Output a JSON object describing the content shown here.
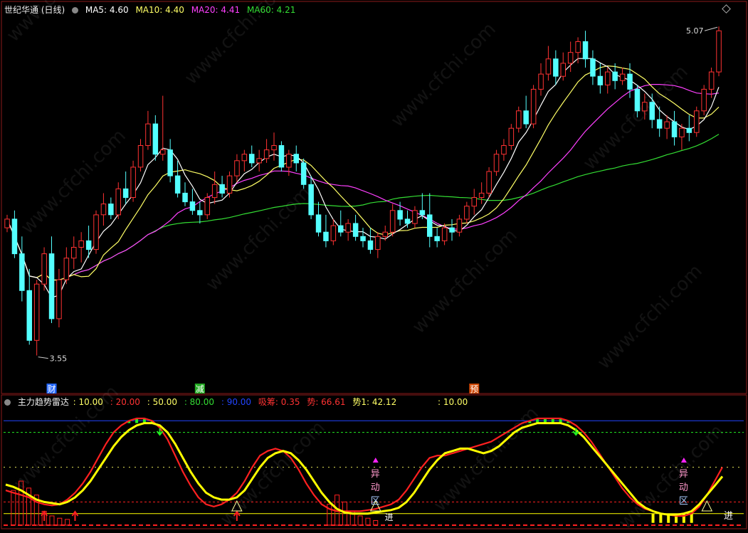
{
  "top_legend": {
    "title": "世纪华通 (日线)",
    "ma5": "MA5: 4.60",
    "ma10": "MA10: 4.40",
    "ma20": "MA20: 4.41",
    "ma60": "MA60: 4.21"
  },
  "bottom_legend": {
    "title": "主力趋势雷达",
    "v1": ": 10.00",
    "v2": ": 20.00",
    "v3": ": 50.00",
    "v4": ": 80.00",
    "v5": ": 90.00",
    "v6": "吸筹: 0.35",
    "v7": "势: 66.61",
    "v8": "势1: 42.12",
    "v9": ": 10.00"
  },
  "colors": {
    "up": "#ff3232",
    "down": "#54ffff",
    "ma5": "#ffffff",
    "ma10": "#ffff66",
    "ma20": "#ff40ff",
    "ma60": "#33dd33",
    "yellow": "#ffff00",
    "red": "#ff2020",
    "green": "#22ee22",
    "blue": "#2244ff"
  },
  "chart_data": [
    {
      "type": "candlestick",
      "title": "世纪华通 (日线)",
      "price_labels": {
        "high": "5.07",
        "low": "3.55"
      },
      "ylim": [
        3.45,
        5.12
      ],
      "event_markers": [
        "财",
        "减",
        "预"
      ],
      "ohlc": [
        [
          4.14,
          4.2,
          4.12,
          4.18
        ],
        [
          4.18,
          4.22,
          4.0,
          4.02
        ],
        [
          4.02,
          4.1,
          3.8,
          3.85
        ],
        [
          3.85,
          3.95,
          3.6,
          3.62
        ],
        [
          3.62,
          3.9,
          3.55,
          3.88
        ],
        [
          3.88,
          4.05,
          3.85,
          4.02
        ],
        [
          4.02,
          4.1,
          3.7,
          3.72
        ],
        [
          3.72,
          3.95,
          3.68,
          3.9
        ],
        [
          3.9,
          4.05,
          3.88,
          4.0
        ],
        [
          4.0,
          4.1,
          3.95,
          4.05
        ],
        [
          4.05,
          4.12,
          3.98,
          4.08
        ],
        [
          4.08,
          4.15,
          4.0,
          4.04
        ],
        [
          4.04,
          4.22,
          4.02,
          4.2
        ],
        [
          4.2,
          4.3,
          4.15,
          4.25
        ],
        [
          4.25,
          4.28,
          4.18,
          4.2
        ],
        [
          4.2,
          4.35,
          4.18,
          4.32
        ],
        [
          4.32,
          4.4,
          4.25,
          4.28
        ],
        [
          4.28,
          4.45,
          4.26,
          4.42
        ],
        [
          4.42,
          4.55,
          4.4,
          4.52
        ],
        [
          4.52,
          4.68,
          4.5,
          4.62
        ],
        [
          4.62,
          4.66,
          4.45,
          4.48
        ],
        [
          4.48,
          4.75,
          4.45,
          4.5
        ],
        [
          4.5,
          4.55,
          4.35,
          4.38
        ],
        [
          4.38,
          4.45,
          4.28,
          4.3
        ],
        [
          4.3,
          4.35,
          4.24,
          4.26
        ],
        [
          4.26,
          4.32,
          4.2,
          4.22
        ],
        [
          4.22,
          4.26,
          4.16,
          4.2
        ],
        [
          4.2,
          4.3,
          4.18,
          4.28
        ],
        [
          4.28,
          4.4,
          4.25,
          4.34
        ],
        [
          4.34,
          4.38,
          4.28,
          4.3
        ],
        [
          4.3,
          4.4,
          4.28,
          4.38
        ],
        [
          4.38,
          4.48,
          4.35,
          4.45
        ],
        [
          4.45,
          4.5,
          4.4,
          4.48
        ],
        [
          4.48,
          4.52,
          4.42,
          4.44
        ],
        [
          4.44,
          4.5,
          4.4,
          4.46
        ],
        [
          4.46,
          4.55,
          4.44,
          4.5
        ],
        [
          4.5,
          4.58,
          4.45,
          4.52
        ],
        [
          4.52,
          4.54,
          4.4,
          4.42
        ],
        [
          4.42,
          4.5,
          4.38,
          4.48
        ],
        [
          4.48,
          4.52,
          4.4,
          4.44
        ],
        [
          4.44,
          4.46,
          4.32,
          4.34
        ],
        [
          4.34,
          4.38,
          4.18,
          4.2
        ],
        [
          4.2,
          4.26,
          4.1,
          4.12
        ],
        [
          4.12,
          4.2,
          4.05,
          4.08
        ],
        [
          4.08,
          4.18,
          4.06,
          4.15
        ],
        [
          4.15,
          4.22,
          4.1,
          4.12
        ],
        [
          4.12,
          4.18,
          4.08,
          4.16
        ],
        [
          4.16,
          4.2,
          4.08,
          4.1
        ],
        [
          4.1,
          4.14,
          4.05,
          4.08
        ],
        [
          4.08,
          4.14,
          4.02,
          4.04
        ],
        [
          4.04,
          4.12,
          4.0,
          4.1
        ],
        [
          4.1,
          4.15,
          4.08,
          4.12
        ],
        [
          4.12,
          4.25,
          4.1,
          4.22
        ],
        [
          4.22,
          4.26,
          4.15,
          4.18
        ],
        [
          4.18,
          4.22,
          4.14,
          4.16
        ],
        [
          4.16,
          4.24,
          4.14,
          4.22
        ],
        [
          4.22,
          4.3,
          4.18,
          4.2
        ],
        [
          4.2,
          4.3,
          4.05,
          4.1
        ],
        [
          4.1,
          4.14,
          4.05,
          4.08
        ],
        [
          4.08,
          4.16,
          4.06,
          4.14
        ],
        [
          4.14,
          4.18,
          4.08,
          4.12
        ],
        [
          4.12,
          4.2,
          4.1,
          4.18
        ],
        [
          4.18,
          4.26,
          4.16,
          4.24
        ],
        [
          4.24,
          4.32,
          4.2,
          4.28
        ],
        [
          4.28,
          4.35,
          4.25,
          4.3
        ],
        [
          4.3,
          4.42,
          4.28,
          4.4
        ],
        [
          4.4,
          4.5,
          4.38,
          4.48
        ],
        [
          4.48,
          4.55,
          4.45,
          4.52
        ],
        [
          4.52,
          4.62,
          4.5,
          4.6
        ],
        [
          4.6,
          4.7,
          4.58,
          4.68
        ],
        [
          4.68,
          4.75,
          4.6,
          4.62
        ],
        [
          4.62,
          4.8,
          4.6,
          4.78
        ],
        [
          4.78,
          4.9,
          4.75,
          4.85
        ],
        [
          4.85,
          4.98,
          4.82,
          4.92
        ],
        [
          4.92,
          4.96,
          4.8,
          4.84
        ],
        [
          4.84,
          4.95,
          4.82,
          4.9
        ],
        [
          4.9,
          5.0,
          4.86,
          4.95
        ],
        [
          4.95,
          5.02,
          4.9,
          5.0
        ],
        [
          5.0,
          5.05,
          4.88,
          4.92
        ],
        [
          4.92,
          4.96,
          4.8,
          4.84
        ],
        [
          4.84,
          4.9,
          4.76,
          4.8
        ],
        [
          4.8,
          4.88,
          4.76,
          4.86
        ],
        [
          4.86,
          4.9,
          4.78,
          4.82
        ],
        [
          4.82,
          4.88,
          4.8,
          4.85
        ],
        [
          4.85,
          4.9,
          4.74,
          4.78
        ],
        [
          4.78,
          4.8,
          4.65,
          4.68
        ],
        [
          4.68,
          4.76,
          4.64,
          4.72
        ],
        [
          4.72,
          4.76,
          4.6,
          4.64
        ],
        [
          4.64,
          4.7,
          4.56,
          4.6
        ],
        [
          4.6,
          4.66,
          4.55,
          4.63
        ],
        [
          4.63,
          4.68,
          4.52,
          4.56
        ],
        [
          4.56,
          4.62,
          4.5,
          4.6
        ],
        [
          4.6,
          4.66,
          4.54,
          4.58
        ],
        [
          4.58,
          4.7,
          4.56,
          4.68
        ],
        [
          4.68,
          4.8,
          4.66,
          4.78
        ],
        [
          4.78,
          4.88,
          4.74,
          4.86
        ],
        [
          4.86,
          5.07,
          4.84,
          5.05
        ]
      ]
    },
    {
      "type": "line",
      "title": "主力趋势雷达",
      "ylim": [
        0,
        100
      ],
      "reference_levels": [
        10,
        20,
        50,
        80,
        90
      ],
      "series": [
        {
          "name": "势",
          "color": "yellow",
          "values": [
            35,
            33,
            30,
            26,
            22,
            20,
            19,
            18,
            20,
            24,
            30,
            38,
            48,
            58,
            68,
            76,
            82,
            86,
            88,
            88,
            86,
            80,
            70,
            58,
            46,
            36,
            28,
            24,
            22,
            22,
            24,
            30,
            40,
            50,
            58,
            62,
            64,
            62,
            56,
            48,
            38,
            28,
            20,
            14,
            11,
            10,
            10,
            10,
            11,
            12,
            13,
            15,
            20,
            28,
            38,
            48,
            56,
            62,
            64,
            66,
            66,
            64,
            62,
            64,
            68,
            74,
            80,
            84,
            86,
            88,
            88,
            88,
            88,
            86,
            82,
            76,
            68,
            60,
            52,
            44,
            36,
            28,
            20,
            15,
            12,
            10,
            9,
            9,
            10,
            12,
            18,
            26,
            34,
            42
          ]
        },
        {
          "name": "势1",
          "color": "red",
          "values": [
            30,
            28,
            26,
            24,
            20,
            18,
            17,
            18,
            22,
            28,
            36,
            46,
            58,
            70,
            80,
            86,
            90,
            92,
            92,
            90,
            84,
            74,
            60,
            46,
            34,
            24,
            18,
            16,
            18,
            22,
            28,
            38,
            50,
            60,
            64,
            66,
            64,
            58,
            48,
            36,
            26,
            18,
            14,
            12,
            12,
            12,
            12,
            13,
            14,
            16,
            18,
            22,
            30,
            40,
            50,
            58,
            60,
            60,
            62,
            64,
            66,
            68,
            70,
            72,
            76,
            80,
            84,
            88,
            90,
            92,
            92,
            92,
            92,
            90,
            86,
            80,
            72,
            62,
            52,
            42,
            32,
            24,
            18,
            14,
            12,
            10,
            9,
            8,
            8,
            10,
            16,
            26,
            38,
            50
          ]
        }
      ]
    }
  ],
  "bottom_markers": {
    "yidong": "异\n动\n区",
    "jin": "进"
  }
}
